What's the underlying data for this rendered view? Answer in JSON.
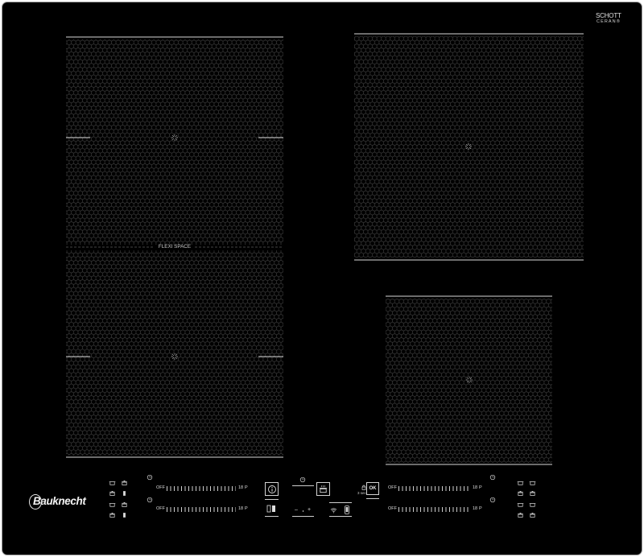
{
  "glass_logo": {
    "line1": "SCHOTT",
    "line2": "CERAN®"
  },
  "brand": {
    "name": "Bauknecht"
  },
  "flexi": {
    "label": "FLEXI SPACE"
  },
  "sliders": {
    "left": [
      {
        "off": "OFF",
        "max": "18",
        "boost": "P"
      },
      {
        "off": "OFF",
        "max": "18",
        "boost": "P"
      }
    ],
    "right": [
      {
        "off": "OFF",
        "max": "18",
        "boost": "P"
      },
      {
        "off": "OFF",
        "max": "18",
        "boost": "P"
      }
    ]
  },
  "timer": {
    "minus": "–",
    "plus": "+"
  },
  "lock": {
    "hold": "3 sec",
    "ok": "OK"
  },
  "panel_icons": [
    "pan-icon",
    "pot-icon",
    "glass-icon",
    "clock-icon",
    "info-icon",
    "bridge-icon",
    "pot-steam-icon",
    "wifi-icon",
    "phone-icon",
    "lock-icon",
    "zone-center-mark"
  ],
  "colors": {
    "glass": "#000000",
    "frame": "#9b9b9b",
    "marking": "#d9d9d9",
    "mesh": "#3a3a3a"
  }
}
